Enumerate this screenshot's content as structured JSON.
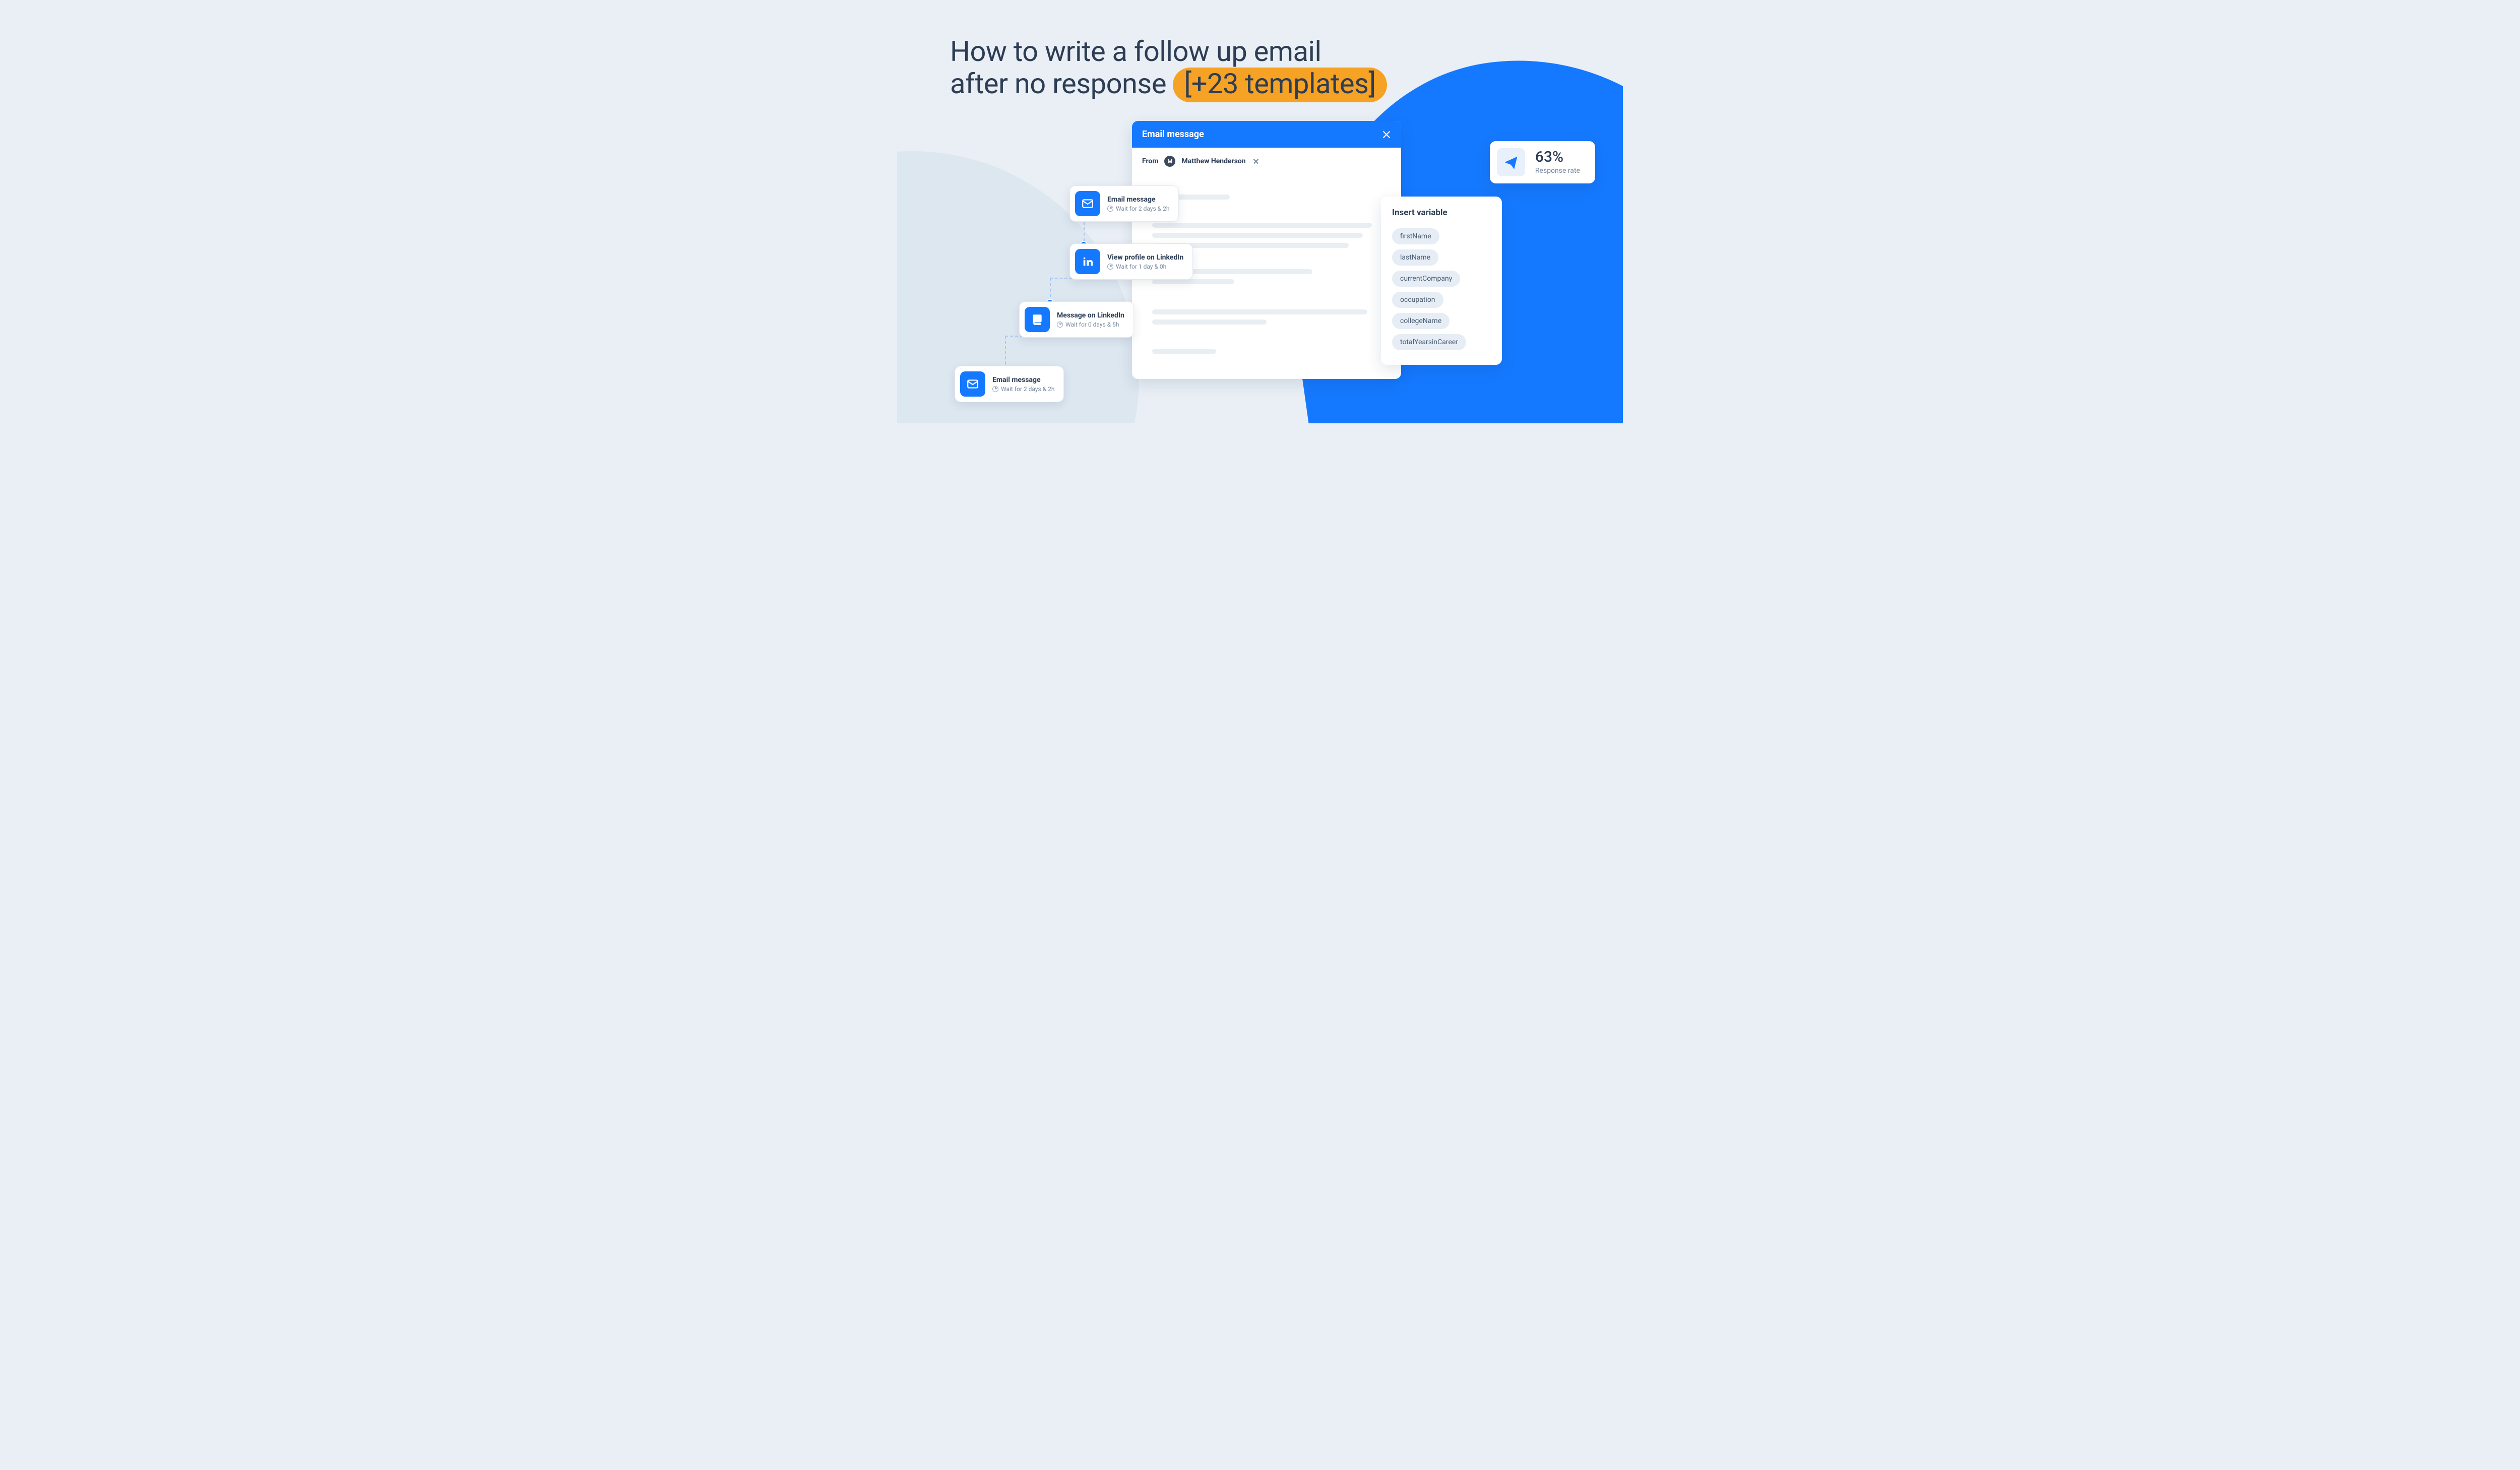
{
  "headline": {
    "line1": "How to write a follow up email",
    "line2_pre": "after no response ",
    "pill": "[+23 templates]"
  },
  "compose": {
    "title": "Email message",
    "from_label": "From",
    "sender_initial": "M",
    "sender_name": "Matthew Henderson"
  },
  "sequence": [
    {
      "title": "Email message",
      "wait": "Wait for 2 days & 2h",
      "icon": "mail"
    },
    {
      "title": "View profile on LinkedIn",
      "wait": "Wait for 1 day & 0h",
      "icon": "linkedin"
    },
    {
      "title": "Message on LinkedIn",
      "wait": "Wait for 0 days & 5h",
      "icon": "li-msg"
    },
    {
      "title": "Email message",
      "wait": "Wait for 2 days & 2h",
      "icon": "mail"
    }
  ],
  "stat": {
    "value": "63%",
    "label": "Response rate"
  },
  "variables": {
    "title": "Insert variable",
    "items": [
      "firstName",
      "lastName",
      "currentCompany",
      "occupation",
      "collegeName",
      "totalYearsinCareer"
    ]
  }
}
